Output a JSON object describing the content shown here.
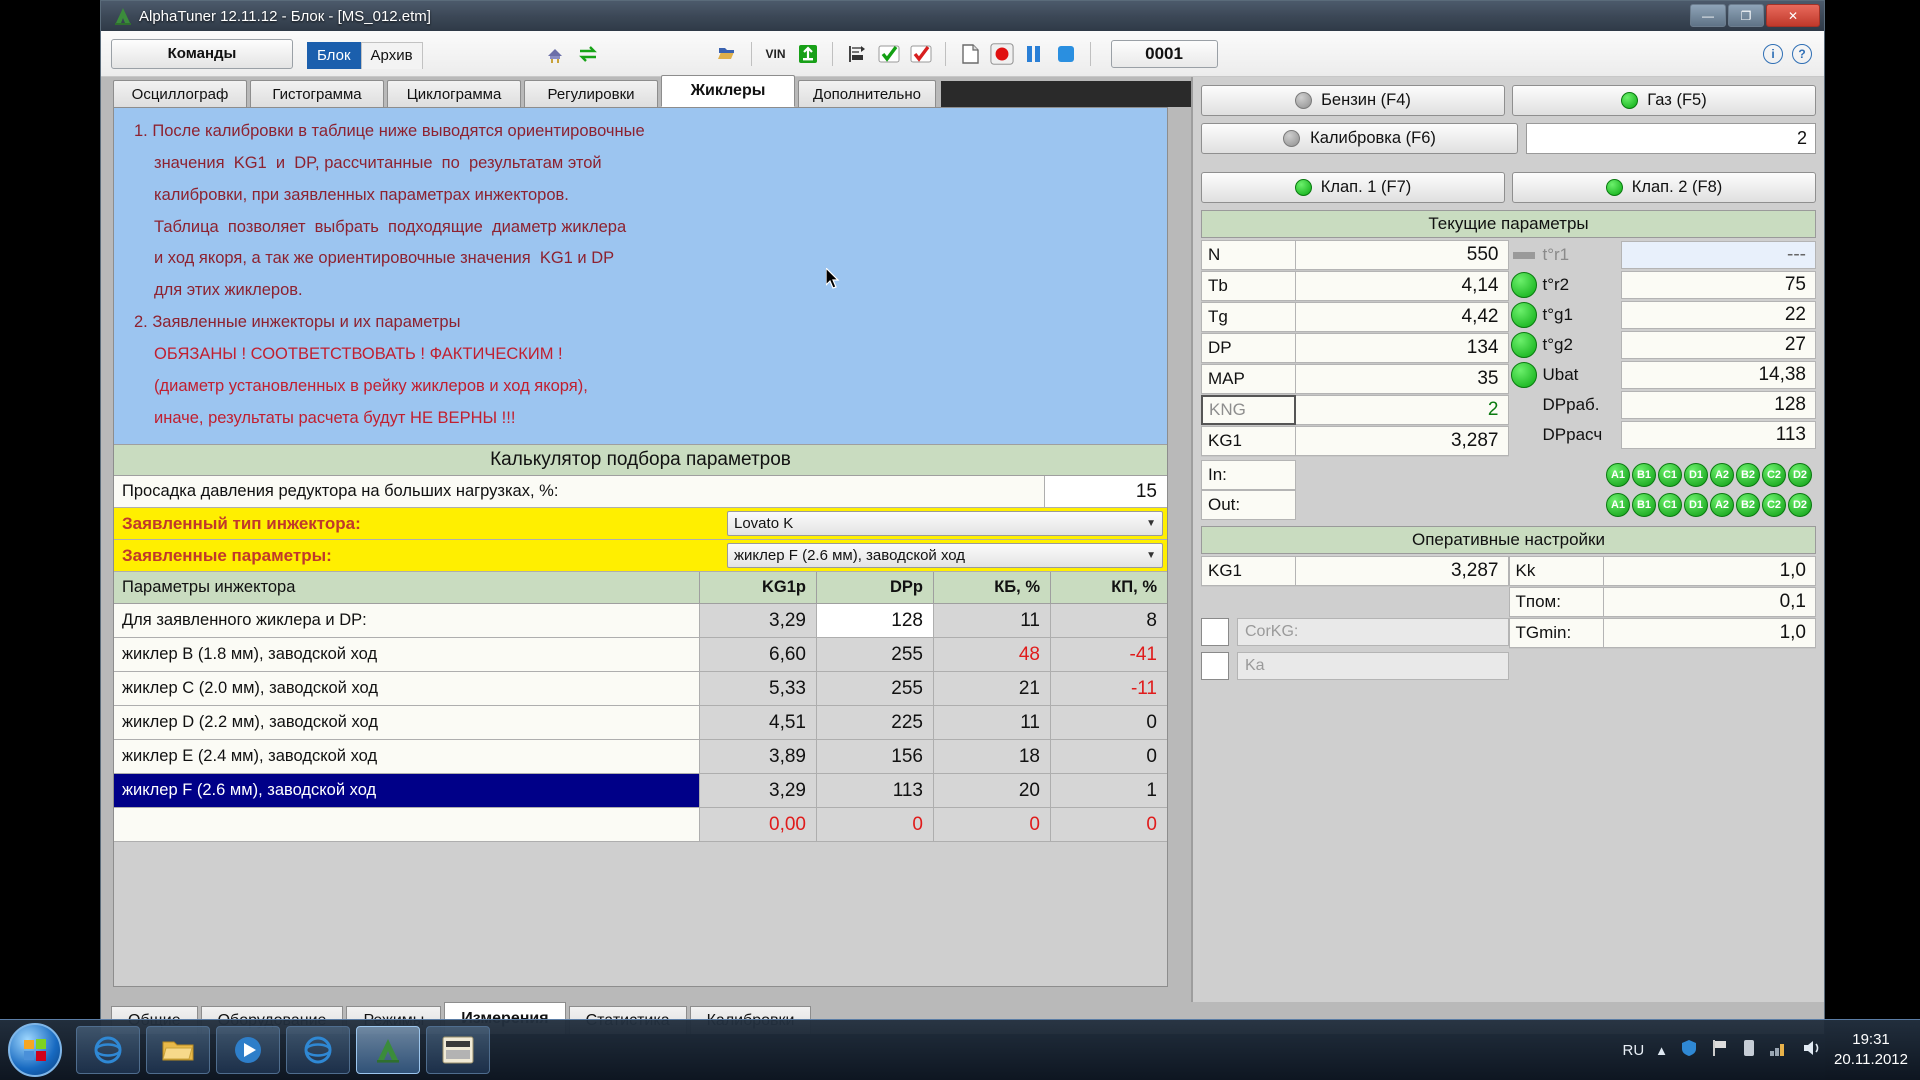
{
  "window": {
    "title": "AlphaTuner 12.11.12 - Блок - [MS_012.etm]",
    "minimize": "—",
    "maximize": "❐",
    "close": "✕"
  },
  "toolbar": {
    "commands_label": "Команды",
    "mini_tabs": [
      {
        "label": "Блок",
        "active": true
      },
      {
        "label": "Архив",
        "active": false
      }
    ],
    "counter_value": "0001",
    "vin_label": "VIN"
  },
  "tabs": [
    {
      "label": "Осциллограф",
      "active": false
    },
    {
      "label": "Гистограмма",
      "active": false
    },
    {
      "label": "Циклограмма",
      "active": false
    },
    {
      "label": "Регулировки",
      "active": false
    },
    {
      "label": "Жиклеры",
      "active": true
    },
    {
      "label": "Дополнительно",
      "active": false
    }
  ],
  "notes": [
    {
      "text": "1. После калибровки в таблице ниже выводятся ориентировочные",
      "indent": false,
      "bright": false
    },
    {
      "text": "значения  KG1  и  DP, рассчитанные  по  результатам этой",
      "indent": true,
      "bright": false
    },
    {
      "text": "калибровки, при заявленных параметрах инжекторов.",
      "indent": true,
      "bright": false
    },
    {
      "text": "Таблица  позволяет  выбрать  подходящие  диаметр жиклера",
      "indent": true,
      "bright": false
    },
    {
      "text": "и ход якоря, а так же ориентировочные значения  KG1 и DP",
      "indent": true,
      "bright": false
    },
    {
      "text": "для этих жиклеров.",
      "indent": true,
      "bright": false
    },
    {
      "text": "2. Заявленные инжекторы и их параметры",
      "indent": false,
      "bright": false
    },
    {
      "text": "ОБЯЗАНЫ ! СООТВЕТСТВОВАТЬ ! ФАКТИЧЕСКИМ !",
      "indent": true,
      "bright": true
    },
    {
      "text": "(диаметр установленных в рейку жиклеров и ход якоря),",
      "indent": true,
      "bright": true
    },
    {
      "text": "иначе, результаты расчета будут НЕ ВЕРНЫ !!!",
      "indent": true,
      "bright": true
    }
  ],
  "calculator": {
    "title": "Калькулятор подбора параметров",
    "pressure_drop_label": "Просадка давления редуктора на больших нагрузках, %:",
    "pressure_drop_value": "15",
    "injector_type_label": "Заявленный тип инжектора:",
    "injector_type_value": "Lovato K",
    "injector_params_label": "Заявленные параметры:",
    "injector_params_value": "жиклер F (2.6 мм), заводской ход",
    "table": {
      "headers": [
        "Параметры инжектора",
        "KG1p",
        "DPp",
        "КБ, %",
        "КП, %"
      ],
      "rows": [
        {
          "label": "Для заявленного жиклера и DP:",
          "kg1p": "3,29",
          "dpp": "128",
          "kb": "11",
          "kp": "8",
          "selected": false,
          "dpp_white": true,
          "kb_neg": false,
          "kp_neg": false
        },
        {
          "label": "жиклер B (1.8 мм), заводской ход",
          "kg1p": "6,60",
          "dpp": "255",
          "kb": "48",
          "kp": "-41",
          "selected": false,
          "dpp_white": false,
          "kb_neg": true,
          "kp_neg": true
        },
        {
          "label": "жиклер C (2.0 мм), заводской ход",
          "kg1p": "5,33",
          "dpp": "255",
          "kb": "21",
          "kp": "-11",
          "selected": false,
          "dpp_white": false,
          "kb_neg": false,
          "kp_neg": true
        },
        {
          "label": "жиклер D (2.2 мм), заводской ход",
          "kg1p": "4,51",
          "dpp": "225",
          "kb": "11",
          "kp": "0",
          "selected": false,
          "dpp_white": false,
          "kb_neg": false,
          "kp_neg": false
        },
        {
          "label": "жиклер E (2.4 мм), заводской ход",
          "kg1p": "3,89",
          "dpp": "156",
          "kb": "18",
          "kp": "0",
          "selected": false,
          "dpp_white": false,
          "kb_neg": false,
          "kp_neg": false
        },
        {
          "label": "жиклер F (2.6 мм), заводской ход",
          "kg1p": "3,29",
          "dpp": "113",
          "kb": "20",
          "kp": "1",
          "selected": true,
          "dpp_white": false,
          "kb_neg": false,
          "kp_neg": false
        },
        {
          "label": "",
          "kg1p": "0,00",
          "dpp": "0",
          "kb": "0",
          "kp": "0",
          "selected": false,
          "dpp_white": false,
          "kb_neg": false,
          "kp_neg": false,
          "last": true
        }
      ]
    }
  },
  "right_panel": {
    "fuel_buttons": [
      {
        "label": "Бензин (F4)",
        "led": "gray"
      },
      {
        "label": "Газ   (F5)",
        "led": "green"
      }
    ],
    "calibration_button": {
      "label": "Калибровка  (F6)",
      "led": "gray"
    },
    "calibration_value": "2",
    "valve_buttons": [
      {
        "label": "Клап. 1 (F7)",
        "led": "green"
      },
      {
        "label": "Клап. 2 (F8)",
        "led": "green"
      }
    ],
    "current_params_title": "Текущие параметры",
    "left_params": [
      {
        "key": "N",
        "value": "550"
      },
      {
        "key": "Tb",
        "value": "4,14"
      },
      {
        "key": "Tg",
        "value": "4,42"
      },
      {
        "key": "DP",
        "value": "134"
      },
      {
        "key": "MAP",
        "value": "35"
      },
      {
        "key": "KNG",
        "value": "2",
        "dim": true,
        "green": true
      },
      {
        "key": "KG1",
        "value": "3,287"
      }
    ],
    "right_params": [
      {
        "key": "t°r1",
        "value": "---",
        "led": "dash",
        "empty": true
      },
      {
        "key": "t°r2",
        "value": "75",
        "led": "green"
      },
      {
        "key": "t°g1",
        "value": "22",
        "led": "green"
      },
      {
        "key": "t°g2",
        "value": "27",
        "led": "green"
      },
      {
        "key": "Ubat",
        "value": "14,38",
        "led": "green"
      },
      {
        "key": "DPраб.",
        "value": "128",
        "led": "none"
      },
      {
        "key": "DPрасч",
        "value": "113",
        "led": "none"
      }
    ],
    "io_rows": [
      {
        "label": "In:",
        "badges": [
          "A1",
          "B1",
          "C1",
          "D1",
          "A2",
          "B2",
          "C2",
          "D2"
        ]
      },
      {
        "label": "Out:",
        "badges": [
          "A1",
          "B1",
          "C1",
          "D1",
          "A2",
          "B2",
          "C2",
          "D2"
        ]
      }
    ],
    "operative_title": "Оперативные настройки",
    "operative_left": [
      {
        "key": "KG1",
        "value": "3,287"
      }
    ],
    "operative_right": [
      {
        "key": "Kk",
        "value": "1,0"
      },
      {
        "key": "Tпом:",
        "value": "0,1"
      },
      {
        "key": "TGmin:",
        "value": "1,0"
      }
    ],
    "checkboxes": [
      {
        "label": "CorKG:",
        "checked": false
      },
      {
        "label": "Ka",
        "checked": false
      }
    ]
  },
  "bottom_tabs": [
    {
      "label": "Общие",
      "active": false
    },
    {
      "label": "Оборудование",
      "active": false
    },
    {
      "label": "Режимы",
      "active": false
    },
    {
      "label": "Измерения",
      "active": true
    },
    {
      "label": "Статистика",
      "active": false
    },
    {
      "label": "Калибровки",
      "active": false
    }
  ],
  "taskbar": {
    "language": "RU",
    "time": "19:31",
    "date": "20.11.2012"
  }
}
